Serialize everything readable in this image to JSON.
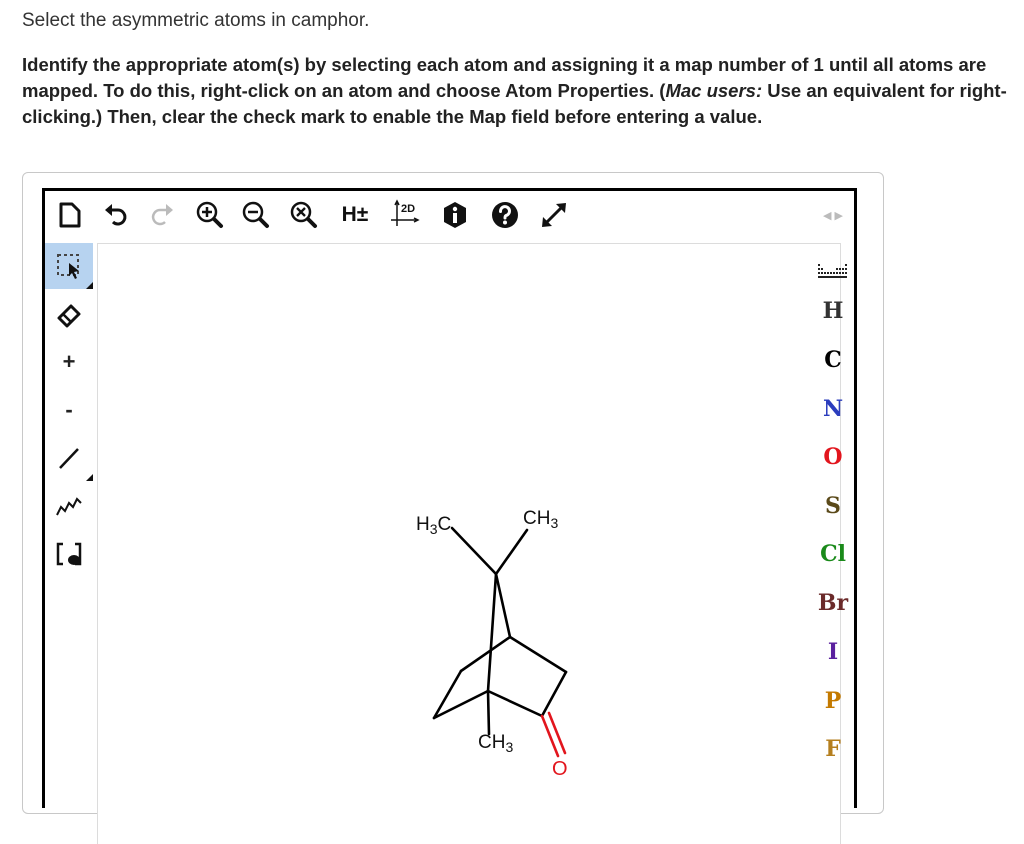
{
  "question": {
    "text": "Select the asymmetric atoms in camphor."
  },
  "instructions": {
    "part1": "Identify the appropriate atom(s) by selecting each atom and assigning it a map number of 1 until all atoms are mapped. To do this, right-click on an atom and choose Atom Properties. (",
    "mac_users": "Mac users:",
    "part2": " Use an equivalent for right-clicking.) Then, clear the check mark to enable the Map field before entering a value."
  },
  "toolbar": {
    "buttons": [
      {
        "name": "new-document",
        "icon": "document-icon"
      },
      {
        "name": "undo",
        "icon": "undo-icon"
      },
      {
        "name": "redo",
        "icon": "redo-icon"
      },
      {
        "name": "zoom-in",
        "icon": "zoom-in-icon"
      },
      {
        "name": "zoom-out",
        "icon": "zoom-out-icon"
      },
      {
        "name": "zoom-reset",
        "icon": "zoom-reset-icon"
      },
      {
        "name": "toggle-hydrogens",
        "icon": "hydrogen-icon",
        "label": "H±"
      },
      {
        "name": "clean-2d",
        "icon": "clean-2d-icon",
        "label": "2D"
      },
      {
        "name": "info",
        "icon": "info-icon"
      },
      {
        "name": "help",
        "icon": "help-icon"
      },
      {
        "name": "fullscreen",
        "icon": "expand-icon"
      }
    ],
    "nav_arrows": "◀ ▶"
  },
  "left_tools": [
    {
      "name": "selection-tool",
      "icon": "selection-icon",
      "selected": true
    },
    {
      "name": "erase-tool",
      "icon": "eraser-icon"
    },
    {
      "name": "increase-charge",
      "label": "+"
    },
    {
      "name": "decrease-charge",
      "label": "-"
    },
    {
      "name": "bond-tool",
      "icon": "single-bond-icon"
    },
    {
      "name": "chain-tool",
      "icon": "chain-icon"
    },
    {
      "name": "bracket-tool",
      "icon": "bracket-icon"
    }
  ],
  "periodic_button": {
    "icon": "periodic-table-icon"
  },
  "atoms": [
    {
      "symbol": "H",
      "color": "#333333"
    },
    {
      "symbol": "C",
      "color": "#000000"
    },
    {
      "symbol": "N",
      "color": "#2b3dbd"
    },
    {
      "symbol": "O",
      "color": "#e2151d"
    },
    {
      "symbol": "S",
      "color": "#5b4a1a"
    },
    {
      "symbol": "Cl",
      "color": "#1a8a1a"
    },
    {
      "symbol": "Br",
      "color": "#6b2a2a"
    },
    {
      "symbol": "I",
      "color": "#5a1f9e"
    },
    {
      "symbol": "P",
      "color": "#c47a00"
    },
    {
      "symbol": "F",
      "color": "#b57f1f"
    }
  ],
  "molecule": {
    "labels": {
      "h3c_left_main": "H",
      "h3c_left_sub": "3",
      "h3c_left_tail": "C",
      "ch3_right_main": "CH",
      "ch3_right_sub": "3",
      "ch3_bottom_main": "CH",
      "ch3_bottom_sub": "3",
      "oxygen": "O"
    }
  }
}
